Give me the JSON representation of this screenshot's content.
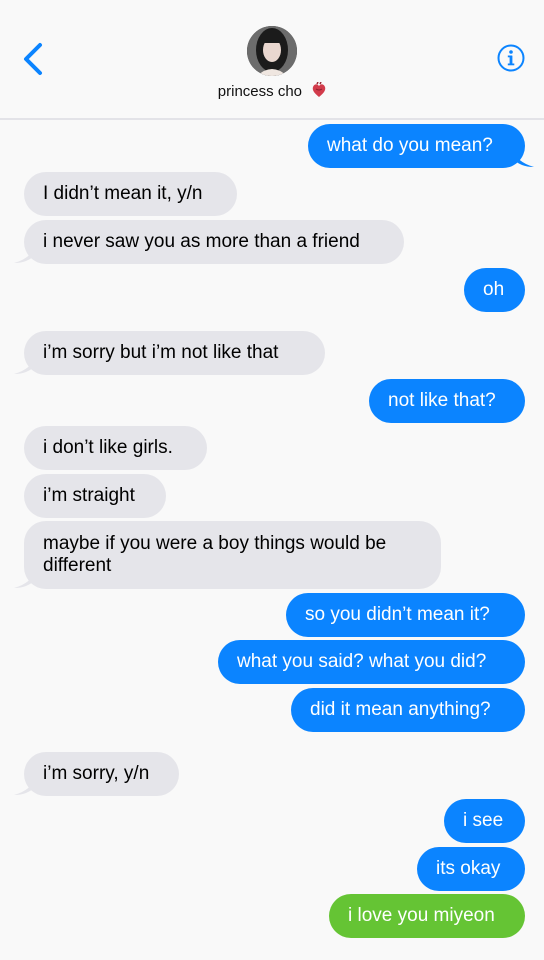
{
  "contact": {
    "name": "princess cho"
  },
  "icons": {
    "back": "chevron-left-icon",
    "info": "info-icon",
    "heart": "anatomical-heart-emoji"
  },
  "colors": {
    "incoming": "#e5e5ea",
    "outgoing": "#0b84ff",
    "sent_green": "#65c434",
    "accent": "#0b84ff"
  },
  "messages": [
    {
      "side": "outgoing",
      "text": "what do you mean?"
    },
    {
      "side": "incoming",
      "text": "I didn’t mean it, y/n"
    },
    {
      "side": "incoming",
      "text": "i never saw you as more than a friend"
    },
    {
      "side": "outgoing",
      "text": "oh"
    },
    {
      "side": "incoming",
      "text": "i’m sorry but i’m not like that"
    },
    {
      "side": "outgoing",
      "text": "not like that?"
    },
    {
      "side": "incoming",
      "text": "i don’t like girls."
    },
    {
      "side": "incoming",
      "text": "i’m straight"
    },
    {
      "side": "incoming",
      "text": "maybe if you were a boy things would be different"
    },
    {
      "side": "outgoing",
      "text": "so you didn’t mean it?"
    },
    {
      "side": "outgoing",
      "text": "what you said? what you did?"
    },
    {
      "side": "outgoing",
      "text": "did it mean anything?"
    },
    {
      "side": "incoming",
      "text": "i’m sorry, y/n"
    },
    {
      "side": "outgoing",
      "text": "i see"
    },
    {
      "side": "outgoing",
      "text": "its okay"
    },
    {
      "side": "outgoing",
      "text": "i love you miyeon"
    }
  ]
}
